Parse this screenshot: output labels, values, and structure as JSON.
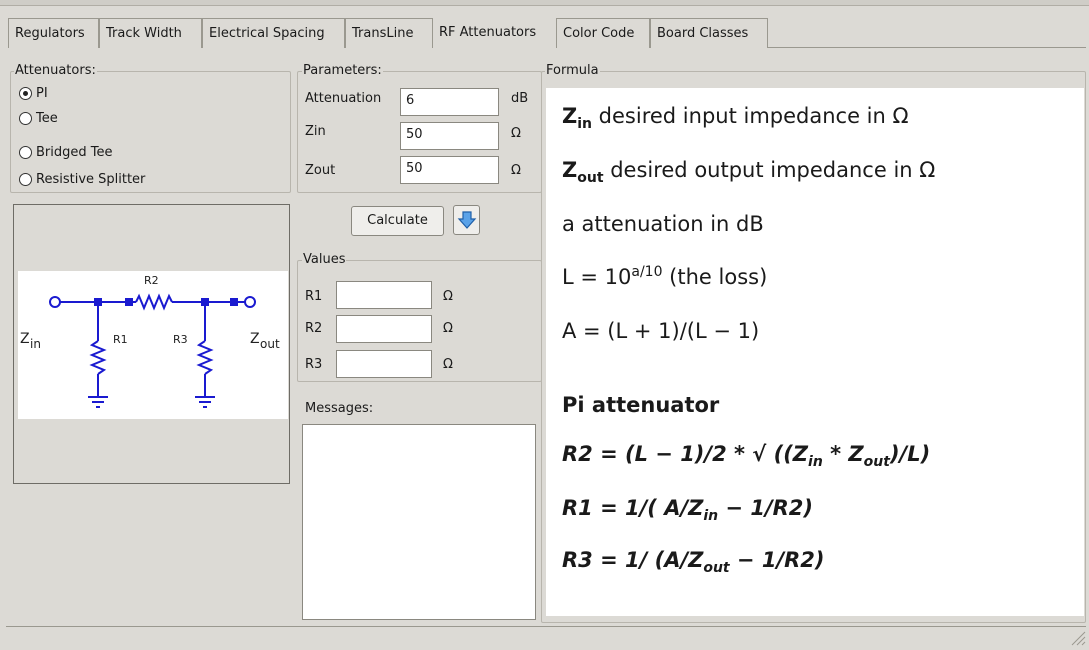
{
  "tabs": [
    "Regulators",
    "Track Width",
    "Electrical Spacing",
    "TransLine",
    "RF Attenuators",
    "Color Code",
    "Board Classes"
  ],
  "active_tab": "RF Attenuators",
  "attenuators": {
    "title": "Attenuators:",
    "options": [
      "PI",
      "Tee",
      "Bridged Tee",
      "Resistive Splitter"
    ],
    "selected": "PI"
  },
  "schematic": {
    "r1": "R1",
    "r2": "R2",
    "r3": "R3",
    "zin": "Z",
    "zin_sub": "in",
    "zout": "Z",
    "zout_sub": "out"
  },
  "parameters": {
    "title": "Parameters:",
    "rows": [
      {
        "label": "Attenuation",
        "value": "6",
        "unit": "dB"
      },
      {
        "label": "Zin",
        "value": "50",
        "unit": "Ω"
      },
      {
        "label": "Zout",
        "value": "50",
        "unit": "Ω"
      }
    ]
  },
  "calculate_label": "Calculate",
  "values": {
    "title": "Values",
    "rows": [
      {
        "label": "R1",
        "value": "",
        "unit": "Ω"
      },
      {
        "label": "R2",
        "value": "",
        "unit": "Ω"
      },
      {
        "label": "R3",
        "value": "",
        "unit": "Ω"
      }
    ]
  },
  "messages": {
    "title": "Messages:",
    "text": ""
  },
  "formula": {
    "title": "Formula",
    "zin_main": "Z",
    "zin_sub": "in",
    "zin_text": " desired input impedance in Ω",
    "zout_main": "Z",
    "zout_sub": "out",
    "zout_text": " desired output impedance in Ω",
    "a_line": "a attenuation in dB",
    "l_pre": "L = 10",
    "l_sup": "a/10",
    "l_post": " (the loss)",
    "a_def": "A = (L + 1)/(L − 1)",
    "heading": "Pi attenuator",
    "r2_pre": "R2 = (L − 1)/2 * √ ((Z",
    "r2_sub1": "in",
    "r2_mid": " * Z",
    "r2_sub2": "out",
    "r2_post": ")/L)",
    "r1_pre": "R1 = 1/( A/Z",
    "r1_sub": "in",
    "r1_post": " − 1/R2)",
    "r3_pre": "R3 = 1/ (A/Z",
    "r3_sub": "out",
    "r3_post": " − 1/R2)"
  }
}
